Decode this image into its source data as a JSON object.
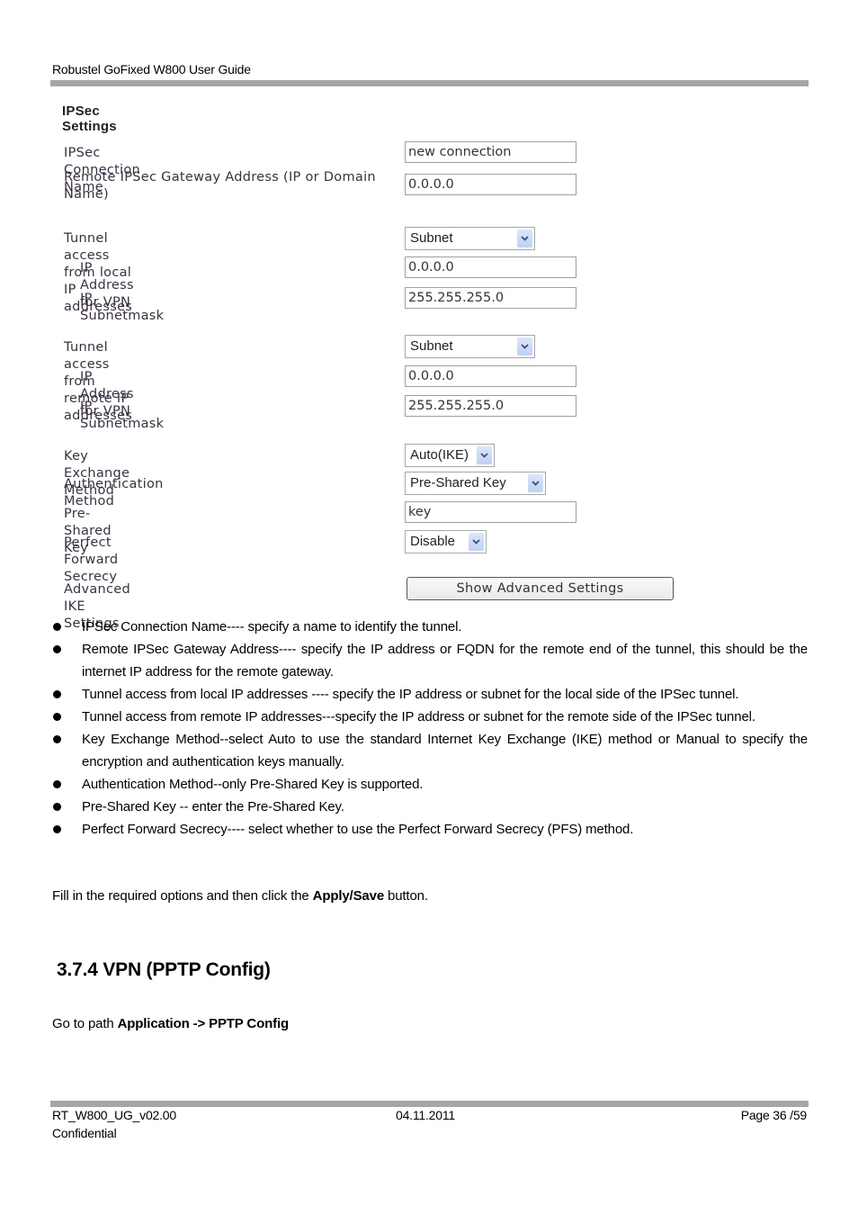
{
  "header": {
    "title": "Robustel GoFixed W800 User Guide"
  },
  "ipsec_form": {
    "title": "IPSec Settings",
    "fields": {
      "connection_name": {
        "label": "IPSec Connection Name",
        "value": "new connection"
      },
      "remote_gateway": {
        "label": "Remote IPSec Gateway Address (IP or Domain Name)",
        "value": "0.0.0.0"
      },
      "local_access": {
        "label": "Tunnel access from local IP addresses",
        "selected": "Subnet"
      },
      "local_ip": {
        "label": "IP Address for VPN",
        "value": "0.0.0.0"
      },
      "local_mask": {
        "label": "IP Subnetmask",
        "value": "255.255.255.0"
      },
      "remote_access": {
        "label": "Tunnel access from remote IP addresses",
        "selected": "Subnet"
      },
      "remote_ip": {
        "label": "IP Address for VPN",
        "value": "0.0.0.0"
      },
      "remote_mask": {
        "label": "IP Subnetmask",
        "value": "255.255.255.0"
      },
      "key_exchange": {
        "label": "Key Exchange Method",
        "selected": "Auto(IKE)"
      },
      "auth_method": {
        "label": "Authentication Method",
        "selected": "Pre-Shared Key"
      },
      "psk": {
        "label": "Pre-Shared Key",
        "value": "key"
      },
      "pfs": {
        "label": "Perfect Forward Secrecy",
        "selected": "Disable"
      },
      "advanced": {
        "label": "Advanced IKE Settings",
        "button": "Show Advanced Settings"
      }
    }
  },
  "bullets": [
    "IPSec Connection Name---- specify a name to identify the tunnel.",
    "Remote IPSec Gateway Address---- specify the IP address or FQDN for the remote end of the tunnel, this should be the internet IP address for the remote gateway.",
    "Tunnel access from local IP addresses ---- specify the IP address or subnet for the local side of the IPSec tunnel.",
    "Tunnel access from remote IP addresses---specify the IP address or subnet for the remote side of the IPSec tunnel.",
    "Key Exchange Method--select Auto to use the standard Internet Key Exchange (IKE) method or Manual to specify the encryption and authentication keys manually.",
    "Authentication Method--only Pre-Shared Key is supported.",
    "Pre-Shared Key -- enter the Pre-Shared Key.",
    "Perfect Forward Secrecy---- select whether to use the Perfect Forward Secrecy (PFS) method."
  ],
  "instruction": {
    "prefix": "Fill in the required options and then click the ",
    "bold": "Apply/Save",
    "suffix": " button."
  },
  "section": {
    "heading": "3.7.4 VPN (PPTP Config)"
  },
  "path": {
    "prefix": "Go to path ",
    "bold": "Application -> PPTP Config"
  },
  "footer": {
    "doc_id": "RT_W800_UG_v02.00",
    "classification": "Confidential",
    "date": "04.11.2011",
    "page": "Page 36 /59"
  }
}
